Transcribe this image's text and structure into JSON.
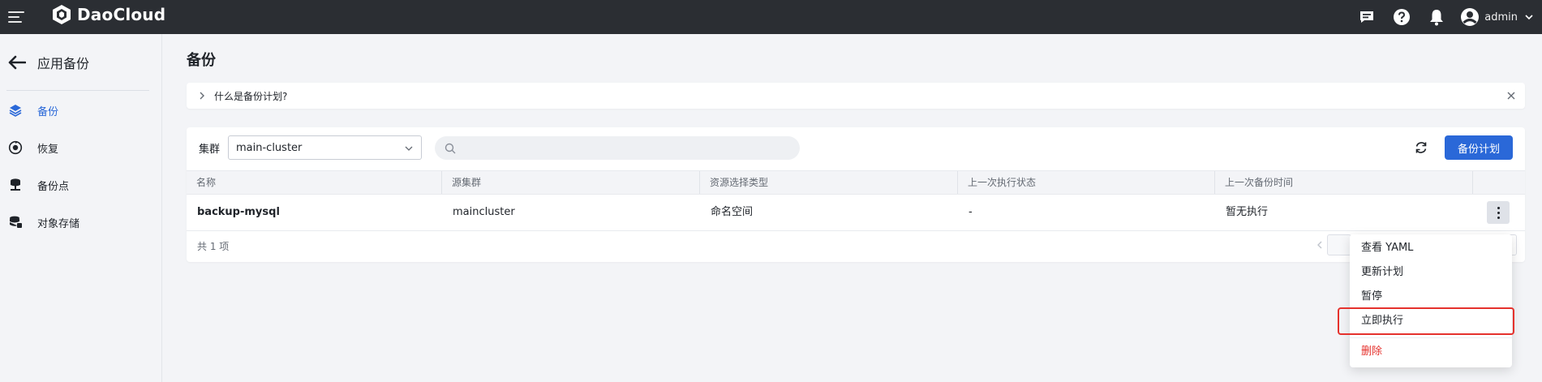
{
  "topbar": {
    "brand": "DaoCloud",
    "user": "admin",
    "icons": [
      "menu-icon",
      "logo-icon",
      "message-icon",
      "help-icon",
      "bell-icon",
      "user-avatar-icon",
      "chevron-down-icon"
    ]
  },
  "sidebar": {
    "title": "应用备份",
    "items": [
      {
        "label": "备份",
        "icon": "layers-icon",
        "active": true
      },
      {
        "label": "恢复",
        "icon": "restore-icon",
        "active": false
      },
      {
        "label": "备份点",
        "icon": "backup-point-icon",
        "active": false
      },
      {
        "label": "对象存储",
        "icon": "object-storage-icon",
        "active": false
      }
    ]
  },
  "main": {
    "title": "备份",
    "info_bar": {
      "text": "什么是备份计划?"
    },
    "toolbar": {
      "cluster_label": "集群",
      "cluster_value": "main-cluster",
      "search_placeholder": "",
      "create_button": "备份计划"
    },
    "table": {
      "columns": [
        "名称",
        "源集群",
        "资源选择类型",
        "上一次执行状态",
        "上一次备份时间"
      ],
      "rows": [
        [
          "backup-mysql",
          "maincluster",
          "命名空间",
          "-",
          "暂无执行"
        ]
      ],
      "total": "共 1 项"
    },
    "menu": {
      "items": [
        {
          "label": "查看 YAML",
          "style": "normal"
        },
        {
          "label": "更新计划",
          "style": "normal"
        },
        {
          "label": "暂停",
          "style": "normal"
        },
        {
          "label": "立即执行",
          "style": "highlight"
        },
        {
          "label": "删除",
          "style": "danger"
        }
      ]
    }
  },
  "colors": {
    "topbar_bg": "#2b2e33",
    "accent": "#2a68d8",
    "danger": "#e5322d",
    "page_bg": "#f3f4f7"
  }
}
